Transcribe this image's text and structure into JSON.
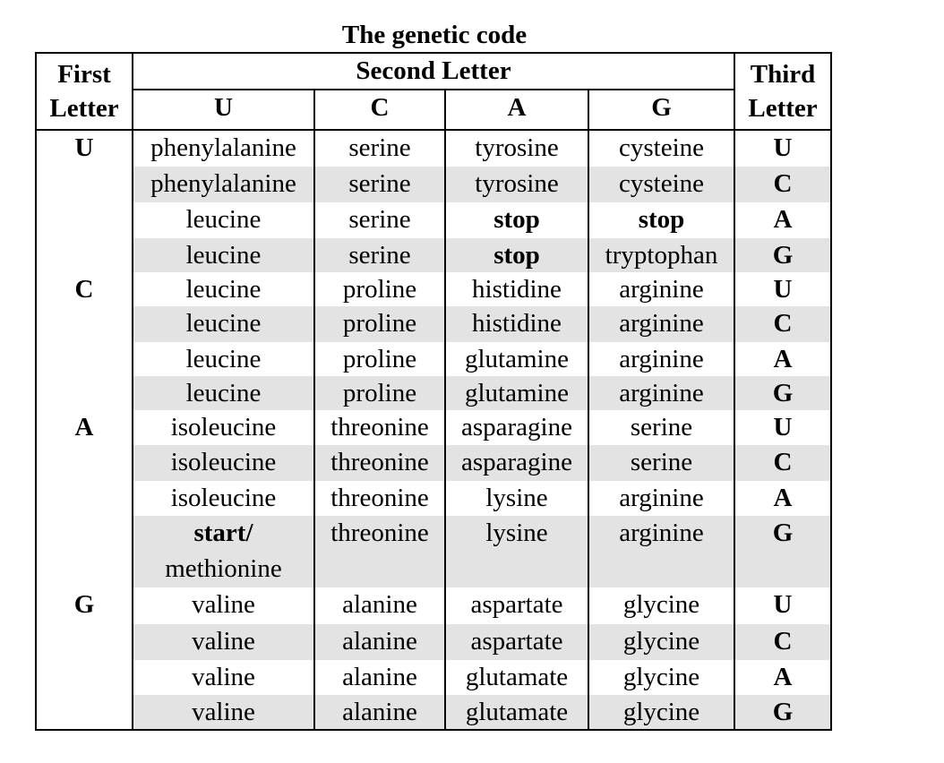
{
  "title": "The genetic code",
  "header": {
    "first_letter": [
      "First",
      "Letter"
    ],
    "second_letter": "Second Letter",
    "third_letter": [
      "Third",
      "Letter"
    ],
    "second_bases": [
      "U",
      "C",
      "A",
      "G"
    ]
  },
  "rows": [
    {
      "first": "U",
      "cells": [
        "phenylalanine",
        "serine",
        "tyrosine",
        "cysteine"
      ],
      "third": "U"
    },
    {
      "first": "",
      "cells": [
        "phenylalanine",
        "serine",
        "tyrosine",
        "cysteine"
      ],
      "third": "C"
    },
    {
      "first": "",
      "cells": [
        "leucine",
        "serine",
        "stop",
        "stop"
      ],
      "third": "A"
    },
    {
      "first": "",
      "cells": [
        "leucine",
        "serine",
        "stop",
        "tryptophan"
      ],
      "third": "G"
    },
    {
      "first": "C",
      "cells": [
        "leucine",
        "proline",
        "histidine",
        "arginine"
      ],
      "third": "U"
    },
    {
      "first": "",
      "cells": [
        "leucine",
        "proline",
        "histidine",
        "arginine"
      ],
      "third": "C"
    },
    {
      "first": "",
      "cells": [
        "leucine",
        "proline",
        "glutamine",
        "arginine"
      ],
      "third": "A"
    },
    {
      "first": "",
      "cells": [
        "leucine",
        "proline",
        "glutamine",
        "arginine"
      ],
      "third": "G"
    },
    {
      "first": "A",
      "cells": [
        "isoleucine",
        "threonine",
        "asparagine",
        "serine"
      ],
      "third": "U"
    },
    {
      "first": "",
      "cells": [
        "isoleucine",
        "threonine",
        "asparagine",
        "serine"
      ],
      "third": "C"
    },
    {
      "first": "",
      "cells": [
        "isoleucine",
        "threonine",
        "lysine",
        "arginine"
      ],
      "third": "A"
    },
    {
      "first": "",
      "cells": [
        "start/",
        "threonine",
        "lysine",
        "arginine"
      ],
      "cell0_line2": "methionine",
      "third": "G"
    },
    {
      "first": "G",
      "cells": [
        "valine",
        "alanine",
        "aspartate",
        "glycine"
      ],
      "third": "U"
    },
    {
      "first": "",
      "cells": [
        "valine",
        "alanine",
        "aspartate",
        "glycine"
      ],
      "third": "C"
    },
    {
      "first": "",
      "cells": [
        "valine",
        "alanine",
        "glutamate",
        "glycine"
      ],
      "third": "A"
    },
    {
      "first": "",
      "cells": [
        "valine",
        "alanine",
        "glutamate",
        "glycine"
      ],
      "third": "G"
    }
  ],
  "colors": {
    "stripe": "#e3e3e3",
    "border": "#000000"
  }
}
